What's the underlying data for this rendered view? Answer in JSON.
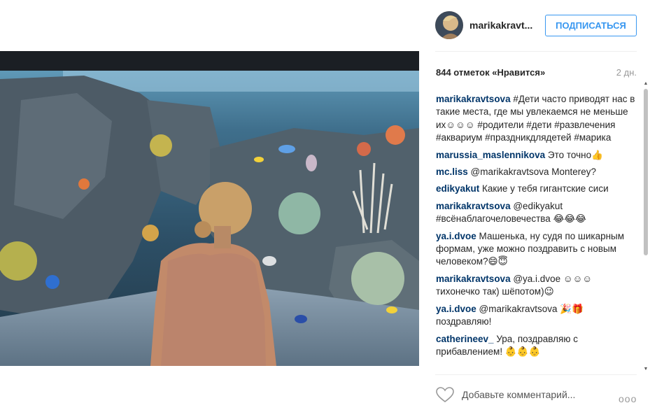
{
  "header": {
    "username": "marikakravt...",
    "follow_label": "ПОДПИСАТЬСЯ"
  },
  "post": {
    "likes": "844 отметок «Нравится»",
    "time_ago": "2 дн.",
    "photo_description_icon": "aquarium-photo"
  },
  "comments": [
    {
      "user": "marikakravtsova",
      "text": "#Дети часто приводят нас в такие места, где мы увлекаемся не меньше их☺☺☺ #родители #дети #развлечения #аквариум #праздникдлядетей #марика"
    },
    {
      "user": "marussia_maslennikova",
      "text": "Это точно👍"
    },
    {
      "user": "mc.liss",
      "text": "@marikakravtsova Monterey?"
    },
    {
      "user": "edikyakut",
      "text": "Какие у тебя гигантские сиси"
    },
    {
      "user": "marikakravtsova",
      "text": "@edikyakut #всёнаблагочеловечества 😂😂😂"
    },
    {
      "user": "ya.i.dvoe",
      "text": "Машенька, ну судя по шикарным формам, уже можно поздравить с новым человеком?😄😇"
    },
    {
      "user": "marikakravtsova",
      "text": "@ya.i.dvoe ☺☺☺ тихонечко так) шёпотом)😉"
    },
    {
      "user": "ya.i.dvoe",
      "text": "@marikakravtsova 🎉🎁 поздравляю!"
    },
    {
      "user": "catherineev_",
      "text": "Ура, поздравляю с прибавлением! 👶👶👶"
    }
  ],
  "footer": {
    "comment_placeholder": "Добавьте комментарий...",
    "more_label": "ооо"
  },
  "colors": {
    "accent": "#3897f0",
    "username": "#003569",
    "muted": "#999999"
  }
}
